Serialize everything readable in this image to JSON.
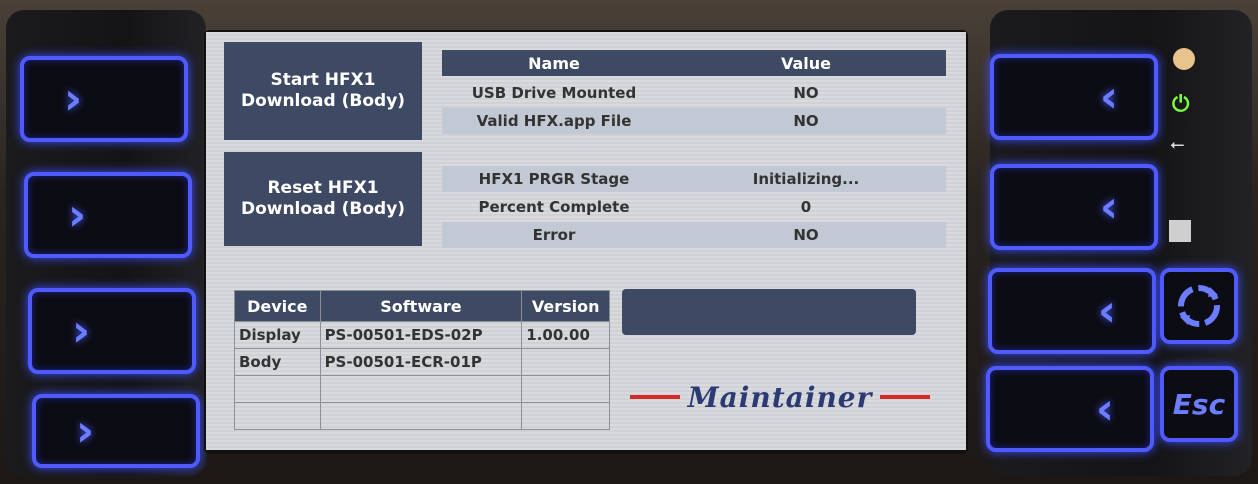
{
  "buttons": {
    "start_download": "Start HFX1 Download (Body)",
    "reset_download": "Reset HFX1 Download (Body)"
  },
  "status_table": {
    "headers": [
      "Name",
      "Value"
    ],
    "rows": [
      {
        "name": "USB Drive Mounted",
        "value": "NO"
      },
      {
        "name": "Valid HFX.app File",
        "value": "NO"
      },
      {
        "name": "",
        "value": ""
      },
      {
        "name": "HFX1 PRGR Stage",
        "value": "Initializing..."
      },
      {
        "name": "Percent Complete",
        "value": "0"
      },
      {
        "name": "Error",
        "value": "NO"
      }
    ]
  },
  "version_table": {
    "headers": [
      "Device",
      "Software",
      "Version"
    ],
    "rows": [
      {
        "device": "Display",
        "software": "PS-00501-EDS-02P",
        "version": "1.00.00"
      },
      {
        "device": "Body",
        "software": "PS-00501-ECR-01P",
        "version": ""
      },
      {
        "device": "",
        "software": "",
        "version": ""
      },
      {
        "device": "",
        "software": "",
        "version": ""
      }
    ]
  },
  "logo": {
    "text": "Maintainer"
  },
  "hardware": {
    "left_key_icon": "chevron-right-icon",
    "right_key_icon": "chevron-left-icon",
    "esc_label": "Esc",
    "accent_color": "#4f5bff"
  }
}
